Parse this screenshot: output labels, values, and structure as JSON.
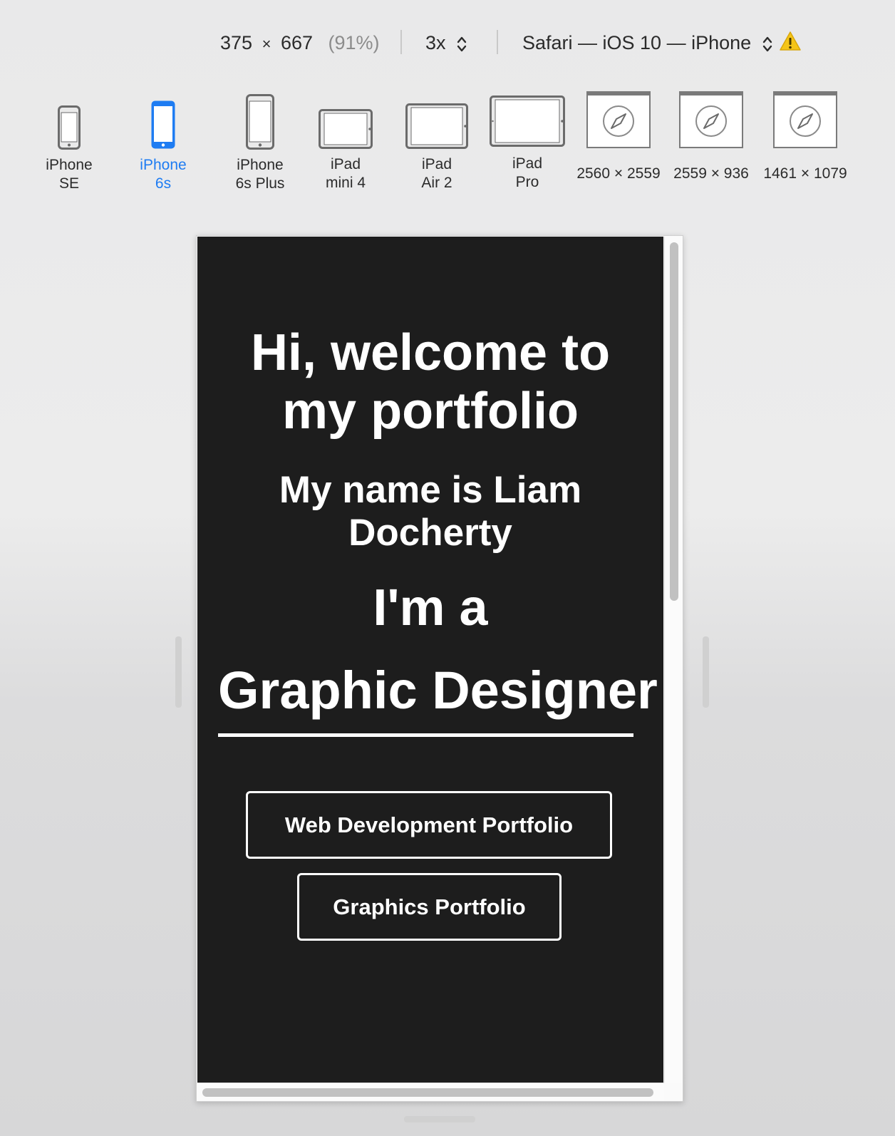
{
  "toolbar": {
    "width": "375",
    "times": "×",
    "height": "667",
    "percent": "(91%)",
    "scale": "3x",
    "user_agent": "Safari — iOS 10 — iPhone"
  },
  "devices": [
    {
      "label": "iPhone\nSE",
      "active": false
    },
    {
      "label": "iPhone\n6s",
      "active": true
    },
    {
      "label": "iPhone\n6s Plus",
      "active": false
    },
    {
      "label": "iPad\nmini 4",
      "active": false
    },
    {
      "label": "iPad\nAir 2",
      "active": false
    },
    {
      "label": "iPad\nPro",
      "active": false
    },
    {
      "label": "2560 × 2559",
      "active": false
    },
    {
      "label": "2559 × 936",
      "active": false
    },
    {
      "label": "1461 × 1079",
      "active": false
    }
  ],
  "colors": {
    "accent": "#1e7cf2",
    "page_background": "#1d1d1d",
    "text": "#ffffff"
  },
  "page": {
    "heading_line1": "Hi, welcome to",
    "heading_line2": "my portfolio",
    "name_line1": "My name is Liam",
    "name_line2": "Docherty",
    "intro": "I'm a",
    "role": "Graphic Designer",
    "web_button": "Web Development Portfolio",
    "graphics_button": "Graphics Portfolio"
  }
}
